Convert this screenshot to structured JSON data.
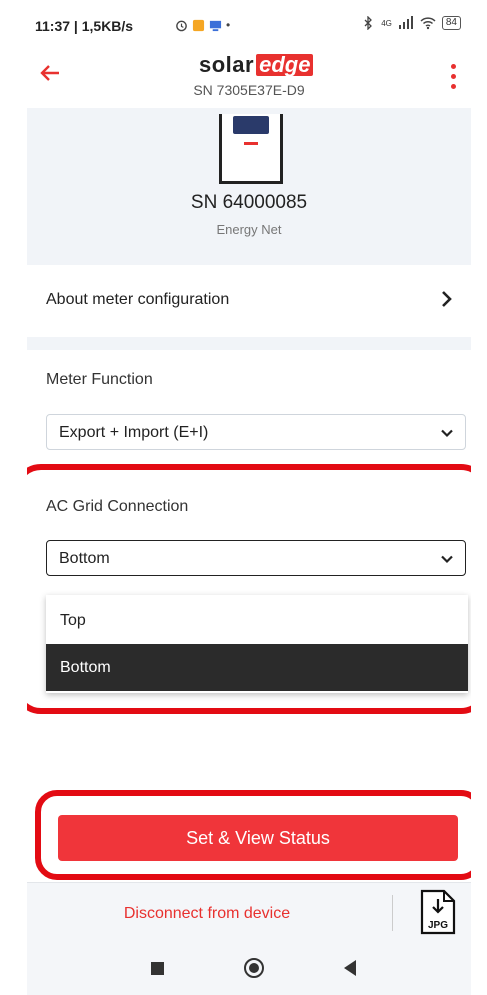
{
  "status_bar": {
    "time": "11:37 | 1,5KB/s",
    "battery": "84",
    "network": "4G"
  },
  "header": {
    "logo_part1": "solar",
    "logo_part2": "edge",
    "serial": "SN 7305E37E-D9",
    "back_icon": "arrow-left-icon",
    "menu_icon": "kebab-menu-icon"
  },
  "device": {
    "serial": "SN 64000085",
    "type": "Energy Net"
  },
  "about": {
    "label": "About meter configuration"
  },
  "form": {
    "meter_function_label": "Meter Function",
    "meter_function_value": "Export + Import (E+I)",
    "ac_grid_label": "AC Grid Connection",
    "ac_grid_value": "Bottom",
    "options": [
      "Top",
      "Bottom"
    ],
    "selected_option": "Bottom"
  },
  "actions": {
    "primary": "Set & View Status",
    "disconnect": "Disconnect from device",
    "jpg_label": "JPG"
  },
  "colors": {
    "accent": "#e8312f",
    "button": "#f0353a",
    "highlight": "#e30b13",
    "selected_option_bg": "#2b2b2b"
  }
}
